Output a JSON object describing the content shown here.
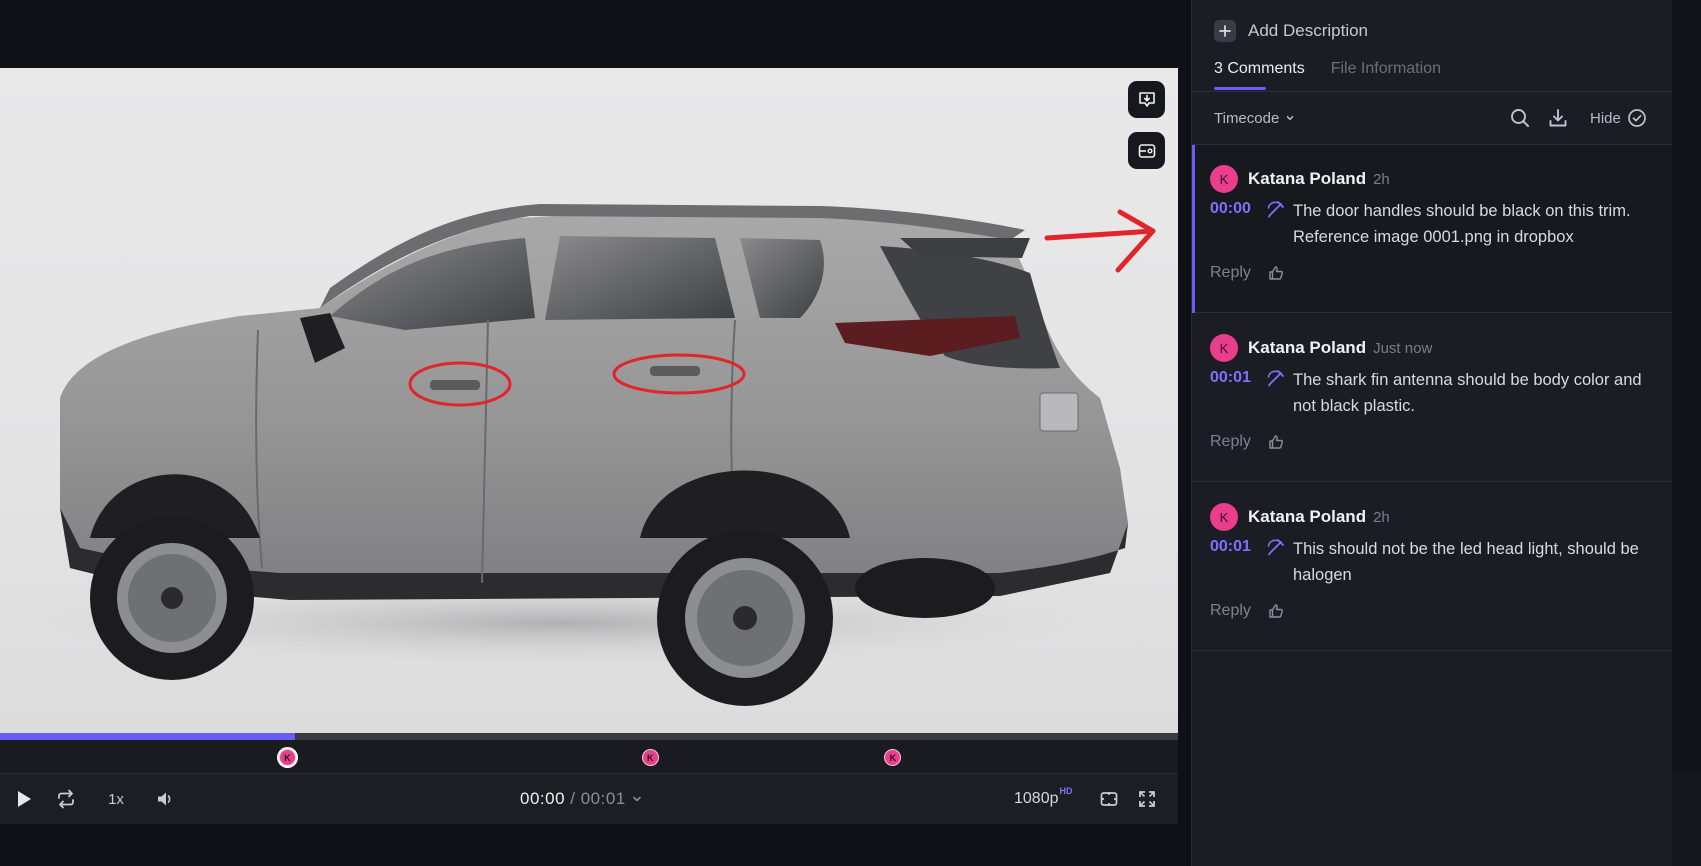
{
  "player": {
    "speed": "1x",
    "current_time": "00:00",
    "separator": " / ",
    "duration": "00:01",
    "quality": "1080p",
    "quality_badge": "HD",
    "progress_fraction": 0.25,
    "marker_avatar": "K",
    "marker_positions": [
      0.244,
      0.552,
      0.758
    ]
  },
  "panel": {
    "add_description": "Add Description",
    "tabs": [
      {
        "label": "3 Comments",
        "active": true
      },
      {
        "label": "File Information",
        "active": false
      }
    ],
    "sort_label": "Timecode",
    "hide_label": "Hide"
  },
  "comments": [
    {
      "avatar": "K",
      "author": "Katana Poland",
      "time": "2h",
      "timecode": "00:00",
      "text": "The door handles should be black on this trim. Reference image 0001.png in dropbox",
      "reply": "Reply"
    },
    {
      "avatar": "K",
      "author": "Katana Poland",
      "time": "Just now",
      "timecode": "00:01",
      "text": "The shark fin antenna should be body color and not black plastic.",
      "reply": "Reply"
    },
    {
      "avatar": "K",
      "author": "Katana Poland",
      "time": "2h",
      "timecode": "00:01",
      "text": "This should not be the led head light,  should be halogen",
      "reply": "Reply"
    }
  ],
  "colors": {
    "accent": "#6a5cf5",
    "avatar": "#e83e8c",
    "annotation": "#e0262a"
  },
  "icons": [
    "play-icon",
    "loop-icon",
    "volume-icon",
    "timecode-dropdown-icon",
    "safe-zone-icon",
    "fullscreen-icon",
    "comment-download-icon",
    "compare-icon",
    "plus-icon",
    "chevron-down-icon",
    "search-icon",
    "download-icon",
    "check-circle-icon",
    "annotation-icon",
    "thumbs-up-icon"
  ]
}
